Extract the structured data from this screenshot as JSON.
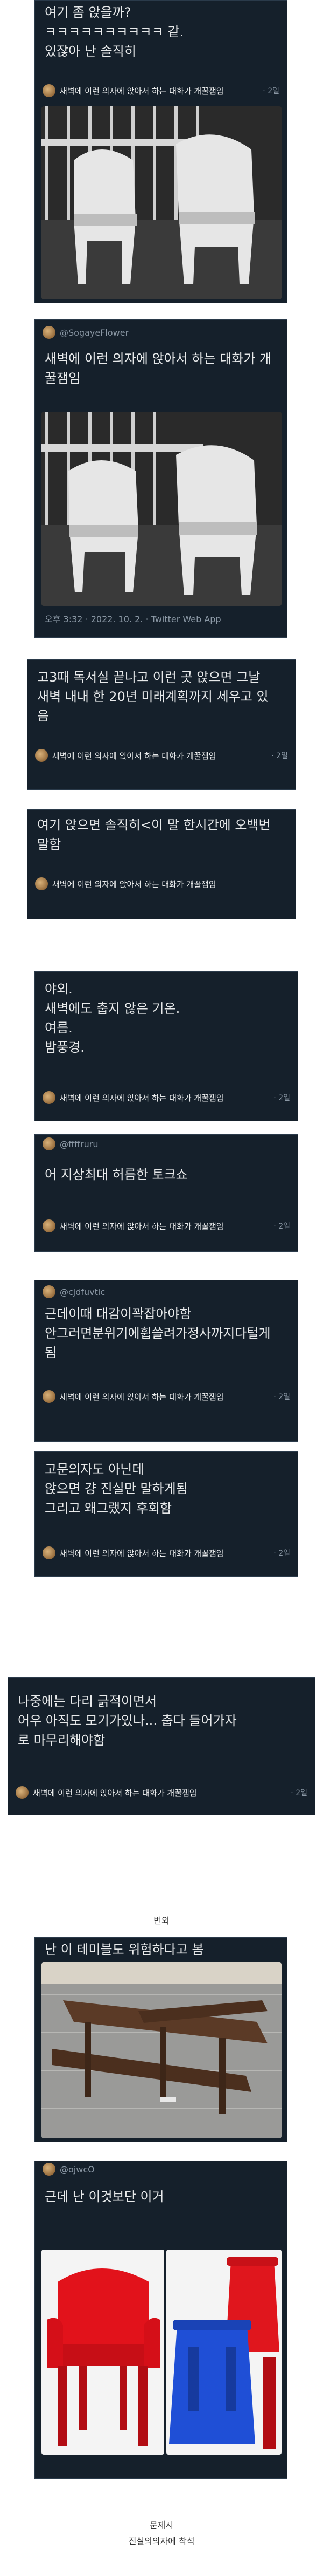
{
  "cards": {
    "c1": {
      "text": "여기 좀 앉을까?\nㅋㅋㅋㅋㅋㅋㅋㅋㅋㅋ 같.\n있잖아 난 솔직히",
      "context": "새벽에 이런 의자에 앉아서 하는 대화가 개꿀잼임",
      "time": "· 2일"
    },
    "c2": {
      "username": "@SogayeFlower",
      "text": "새벽에 이런 의자에 앉아서 하는 대화가 개\n꿀잼임",
      "meta": "오후 3:32 · 2022. 10. 2. · Twitter Web App"
    },
    "c3": {
      "text": "고3때 독서실 끝나고 이런 곳 앉으면 그날\n새벽 내내 한 20년 미래계획까지 세우고 있\n음",
      "context": "새벽에 이런 의자에 앉아서 하는 대화가 개꿀잼임",
      "time": "· 2일"
    },
    "c4": {
      "text": "여기 앉으면 솔직히<이 말 한시간에 오백번\n말함",
      "context": "새벽에 이런 의자에 앉아서 하는 대화가 개꿀잼임",
      "time": "· 2일"
    },
    "c5": {
      "text": "야외.\n새벽에도 춥지 않은 기온.\n여름.\n밤풍경.",
      "context": "새벽에 이런 의자에 앉아서 하는 대화가 개꿀잼임",
      "time": "· 2일"
    },
    "c6": {
      "username": "@ffffruru",
      "text": "어 지상최대 허름한 토크쇼",
      "context": "새벽에 이런 의자에 앉아서 하는 대화가 개꿀잼임",
      "time": "· 2일"
    },
    "c7": {
      "username": "@cjdfuvtic",
      "text": "근데이때 대감이꽉잡아야함\n안그러면분위기에휩쓸려가정사까지다털게\n됨",
      "context": "새벽에 이런 의자에 앉아서 하는 대화가 개꿀잼임",
      "time": "· 2일"
    },
    "c8": {
      "text": "고문의자도 아닌데\n앉으면 걍 진실만 말하게됨\n그리고 왜그랬지 후회함",
      "context": "새벽에 이런 의자에 앉아서 하는 대화가 개꿀잼임",
      "time": "· 2일"
    },
    "c9": {
      "text": "나중에는 다리 긁적이면서\n어우 아직도 모기가있나... 춥다 들어가자\n로 마무리해야함",
      "context": "새벽에 이런 의자에 앉아서 하는 대화가 개꿀잼임",
      "time": "· 2일"
    },
    "c10": {
      "text": "난 이 테미블도 위험하다고 봄"
    },
    "c11": {
      "username": "@ojwcO",
      "text": "근데 난 이것보단 이거"
    }
  },
  "captions": {
    "bonus": "번외",
    "footer1": "문제시",
    "footer2": "진실의의자에 착석"
  },
  "colors": {
    "card_bg": "#15202b",
    "text": "#e7e9ea",
    "muted": "#8b98a5",
    "link": "#1d9bf0",
    "page_bg": "#ffffff"
  },
  "icons": {
    "avatar": "avatar-icon"
  }
}
